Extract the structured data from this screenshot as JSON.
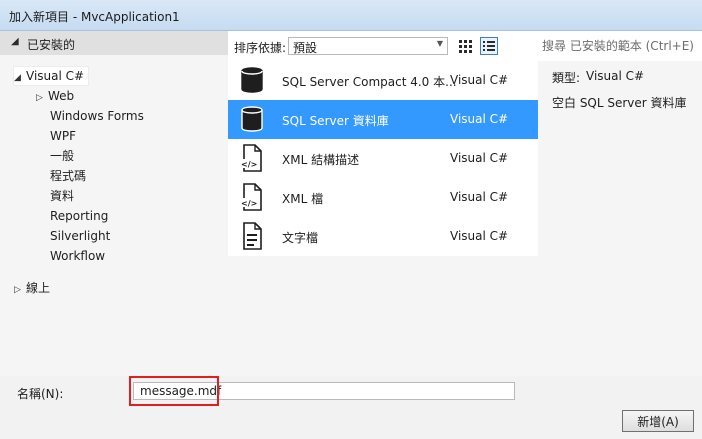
{
  "window": {
    "title": "加入新項目 - MvcApplication1"
  },
  "left_pane": {
    "header": "已安裝的",
    "tree": [
      {
        "label": "Visual C#",
        "expander": "◢",
        "level": 0,
        "selected": true
      },
      {
        "label": "Web",
        "expander": "▷",
        "level": 1
      },
      {
        "label": "Windows Forms",
        "expander": "",
        "level": 1
      },
      {
        "label": "WPF",
        "expander": "",
        "level": 1
      },
      {
        "label": "一般",
        "expander": "",
        "level": 1
      },
      {
        "label": "程式碼",
        "expander": "",
        "level": 1
      },
      {
        "label": "資料",
        "expander": "",
        "level": 1
      },
      {
        "label": "Reporting",
        "expander": "",
        "level": 1
      },
      {
        "label": "Silverlight",
        "expander": "",
        "level": 1
      },
      {
        "label": "Workflow",
        "expander": "",
        "level": 1
      },
      {
        "label": "線上",
        "expander": "▷",
        "level": 0
      }
    ]
  },
  "sort": {
    "label": "排序依據:",
    "value": "預設"
  },
  "items": [
    {
      "name": "SQL Server Compact 4.0 本...",
      "type": "Visual C#",
      "icon": "database-icon",
      "selected": false
    },
    {
      "name": "SQL Server 資料庫",
      "type": "Visual C#",
      "icon": "database-icon",
      "selected": true
    },
    {
      "name": "XML 結構描述",
      "type": "Visual C#",
      "icon": "xml-file-icon",
      "selected": false
    },
    {
      "name": "XML 檔",
      "type": "Visual C#",
      "icon": "xml-file-icon",
      "selected": false
    },
    {
      "name": "文字檔",
      "type": "Visual C#",
      "icon": "text-file-icon",
      "selected": false
    }
  ],
  "search": {
    "placeholder": "搜尋 已安裝的範本 (Ctrl+E)"
  },
  "details": {
    "type_label": "類型:",
    "type_value": "Visual C#",
    "description": "空白 SQL Server 資料庫"
  },
  "bottom": {
    "name_label": "名稱(N):",
    "name_value": "message.mdf",
    "add_button": "新增(A)"
  },
  "colors": {
    "selection": "#3399ff",
    "highlight_box": "#e02020"
  }
}
